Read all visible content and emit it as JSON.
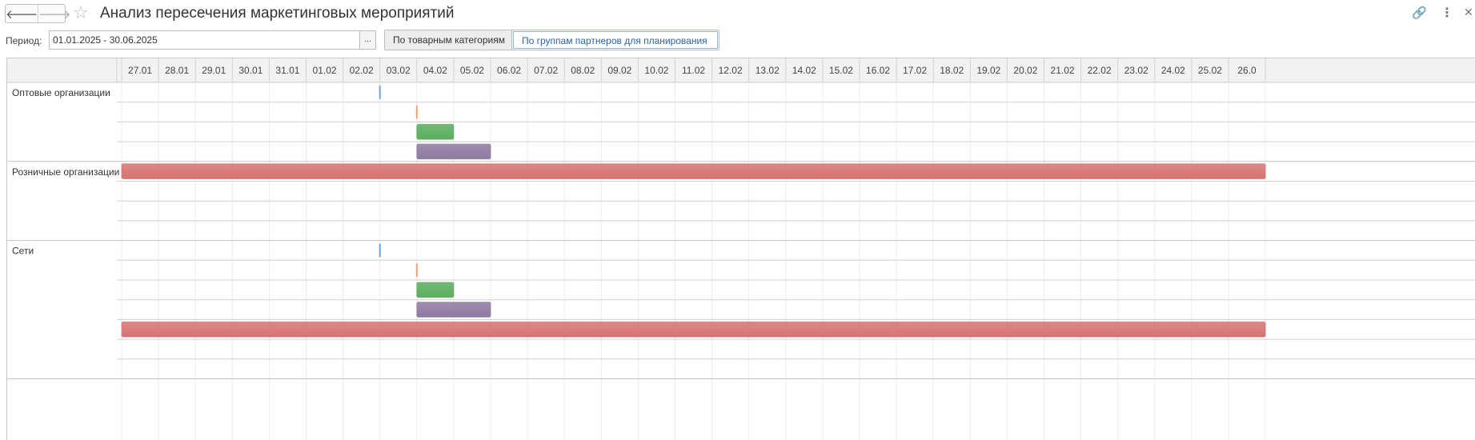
{
  "nav": {
    "back_icon": "arrow-left",
    "forward_icon": "arrow-right"
  },
  "title": "Анализ пересечения маркетинговых мероприятий",
  "header_actions": {
    "link_icon": "link-icon",
    "more_icon": "more-vertical-icon",
    "close_icon": "close-icon"
  },
  "period": {
    "label": "Период:",
    "value": "01.01.2025 - 30.06.2025",
    "picker_label": "..."
  },
  "grouping": {
    "options": [
      "По товарным категориям",
      "По группам партнеров для планирования"
    ],
    "selected": "По группам партнеров для планирования"
  },
  "chart_data": {
    "type": "gantt",
    "dates": [
      "27.01",
      "28.01",
      "29.01",
      "30.01",
      "31.01",
      "01.02",
      "02.02",
      "03.02",
      "04.02",
      "05.02",
      "06.02",
      "07.02",
      "08.02",
      "09.02",
      "10.02",
      "11.02",
      "12.02",
      "13.02",
      "14.02",
      "15.02",
      "16.02",
      "17.02",
      "18.02",
      "19.02",
      "20.02",
      "21.02",
      "22.02",
      "23.02",
      "24.02",
      "25.02",
      "26.0"
    ],
    "colors": {
      "line_blue": "#6fa3dc",
      "line_orange": "#f0a07a",
      "bar_green": "#5aad5e",
      "bar_purple": "#8e7aa0",
      "bar_red": "#d77272"
    },
    "groups": [
      {
        "label": "Оптовые организации",
        "rows": [
          {
            "kind": "line",
            "color": "line_blue",
            "at": 7
          },
          {
            "kind": "line",
            "color": "line_orange",
            "at": 8
          },
          {
            "kind": "bar",
            "color": "bar_green",
            "start": 8,
            "end": 9
          },
          {
            "kind": "bar",
            "color": "bar_purple",
            "start": 8,
            "end": 10
          }
        ]
      },
      {
        "label": "Розничные организации",
        "rows": [
          {
            "kind": "bar",
            "color": "bar_red",
            "start": 0,
            "end": 31
          },
          {
            "kind": "empty"
          },
          {
            "kind": "empty"
          },
          {
            "kind": "empty"
          }
        ]
      },
      {
        "label": "Сети",
        "rows": [
          {
            "kind": "line",
            "color": "line_blue",
            "at": 7
          },
          {
            "kind": "line",
            "color": "line_orange",
            "at": 8
          },
          {
            "kind": "bar",
            "color": "bar_green",
            "start": 8,
            "end": 9
          },
          {
            "kind": "bar",
            "color": "bar_purple",
            "start": 8,
            "end": 10
          },
          {
            "kind": "bar",
            "color": "bar_red",
            "start": 0,
            "end": 31
          },
          {
            "kind": "empty"
          },
          {
            "kind": "empty"
          }
        ]
      }
    ]
  }
}
